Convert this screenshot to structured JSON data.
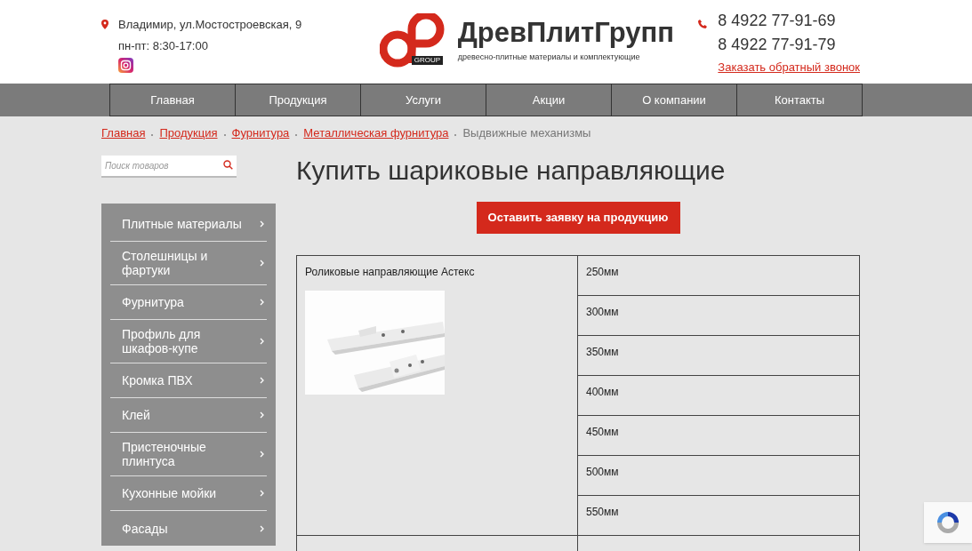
{
  "header": {
    "address": "Владимир, ул.Мостостроевская, 9",
    "hours": "пн-пт: 8:30-17:00",
    "logo_badge": "GROUP",
    "brand": "ДревПлитГрупп",
    "tagline": "древесно-плитные материалы и комплектующие",
    "phones": [
      "8 4922 77-91-69",
      "8 4922 77-91-79"
    ],
    "callback": "Заказать обратный звонок"
  },
  "nav": [
    {
      "label": "Главная",
      "selected": false
    },
    {
      "label": "Продукция",
      "selected": false
    },
    {
      "label": "Услуги",
      "selected": false
    },
    {
      "label": "Акции",
      "selected": false
    },
    {
      "label": "О компании",
      "selected": false
    },
    {
      "label": "Контакты",
      "selected": false
    }
  ],
  "breadcrumbs": [
    {
      "label": "Главная",
      "link": true
    },
    {
      "label": "Продукция",
      "link": true
    },
    {
      "label": "Фурнитура",
      "link": true
    },
    {
      "label": "Металлическая фурнитура",
      "link": true
    },
    {
      "label": "Выдвижные механизмы",
      "link": false
    }
  ],
  "search": {
    "placeholder": "Поиск товаров"
  },
  "sidebar": {
    "items": [
      "Плитные материалы",
      "Столешницы и фартуки",
      "Фурнитура",
      "Профиль для шкафов-купе",
      "Кромка ПВХ",
      "Клей",
      "Пристеночные плинтуса",
      "Кухонные мойки",
      "Фасады"
    ]
  },
  "title": "Купить шариковые направляющие",
  "order_button": "Оставить заявку на продукцию",
  "table": {
    "product": "Роликовые направляющие Астекс",
    "sizes": [
      "250мм",
      "300мм",
      "350мм",
      "400мм",
      "450мм",
      "500мм",
      "550мм"
    ]
  }
}
